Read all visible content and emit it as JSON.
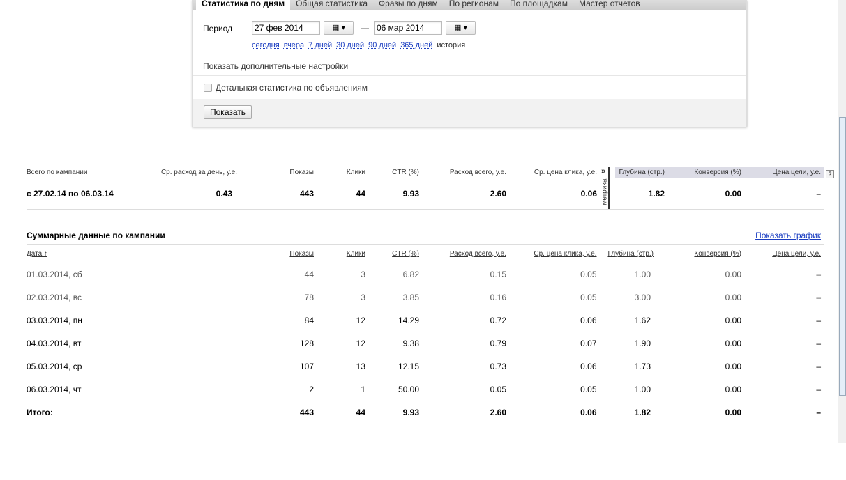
{
  "tabs": [
    "Статистика по дням",
    "Общая статистика",
    "Фразы по дням",
    "По регионам",
    "По площадкам",
    "Мастер отчетов"
  ],
  "period": {
    "label": "Период",
    "from": "27 фев 2014",
    "to": "06 мар 2014",
    "dash": "—",
    "cal_icon": "calendar-icon ▾"
  },
  "quick_links": [
    "сегодня",
    "вчера",
    "7 дней",
    "30 дней",
    "90 дней",
    "365 дней"
  ],
  "history": "история",
  "more_settings": "Показать дополнительные настройки",
  "detail_checkbox": {
    "label": "Детальная статистика по объявлениям",
    "checked": false
  },
  "show_button": "Показать",
  "summary": {
    "headers": [
      "Всего по кампании",
      "Ср. расход за день, у.е.",
      "Показы",
      "Клики",
      "CTR (%)",
      "Расход всего, у.е.",
      "Ср. цена клика, у.е.",
      "Глубина (стр.)",
      "Конверсия (%)",
      "Цена цели, у.е."
    ],
    "row": [
      "с 27.02.14 по 06.03.14",
      "0.43",
      "443",
      "44",
      "9.93",
      "2.60",
      "0.06",
      "1.82",
      "0.00",
      "–"
    ],
    "metrika": "метрика",
    "metrika_arrow": "»",
    "help": "?"
  },
  "daily": {
    "title": "Суммарные данные по кампании",
    "chart_link": "Показать график",
    "headers": [
      "Дата ↑",
      "Показы",
      "Клики",
      "CTR (%)",
      "Расход всего, у.е.",
      "Ср. цена клика, у.е.",
      "Глубина (стр.)",
      "Конверсия (%)",
      "Цена цели, у.е."
    ],
    "rows": [
      [
        "01.03.2014, сб",
        "44",
        "3",
        "6.82",
        "0.15",
        "0.05",
        "1.00",
        "0.00",
        "–"
      ],
      [
        "02.03.2014, вс",
        "78",
        "3",
        "3.85",
        "0.16",
        "0.05",
        "3.00",
        "0.00",
        "–"
      ],
      [
        "03.03.2014, пн",
        "84",
        "12",
        "14.29",
        "0.72",
        "0.06",
        "1.62",
        "0.00",
        "–"
      ],
      [
        "04.03.2014, вт",
        "128",
        "12",
        "9.38",
        "0.79",
        "0.07",
        "1.90",
        "0.00",
        "–"
      ],
      [
        "05.03.2014, ср",
        "107",
        "13",
        "12.15",
        "0.73",
        "0.06",
        "1.73",
        "0.00",
        "–"
      ],
      [
        "06.03.2014, чт",
        "2",
        "1",
        "50.00",
        "0.05",
        "0.05",
        "1.00",
        "0.00",
        "–"
      ]
    ],
    "total": [
      "Итого:",
      "443",
      "44",
      "9.93",
      "2.60",
      "0.06",
      "1.82",
      "0.00",
      "–"
    ]
  }
}
